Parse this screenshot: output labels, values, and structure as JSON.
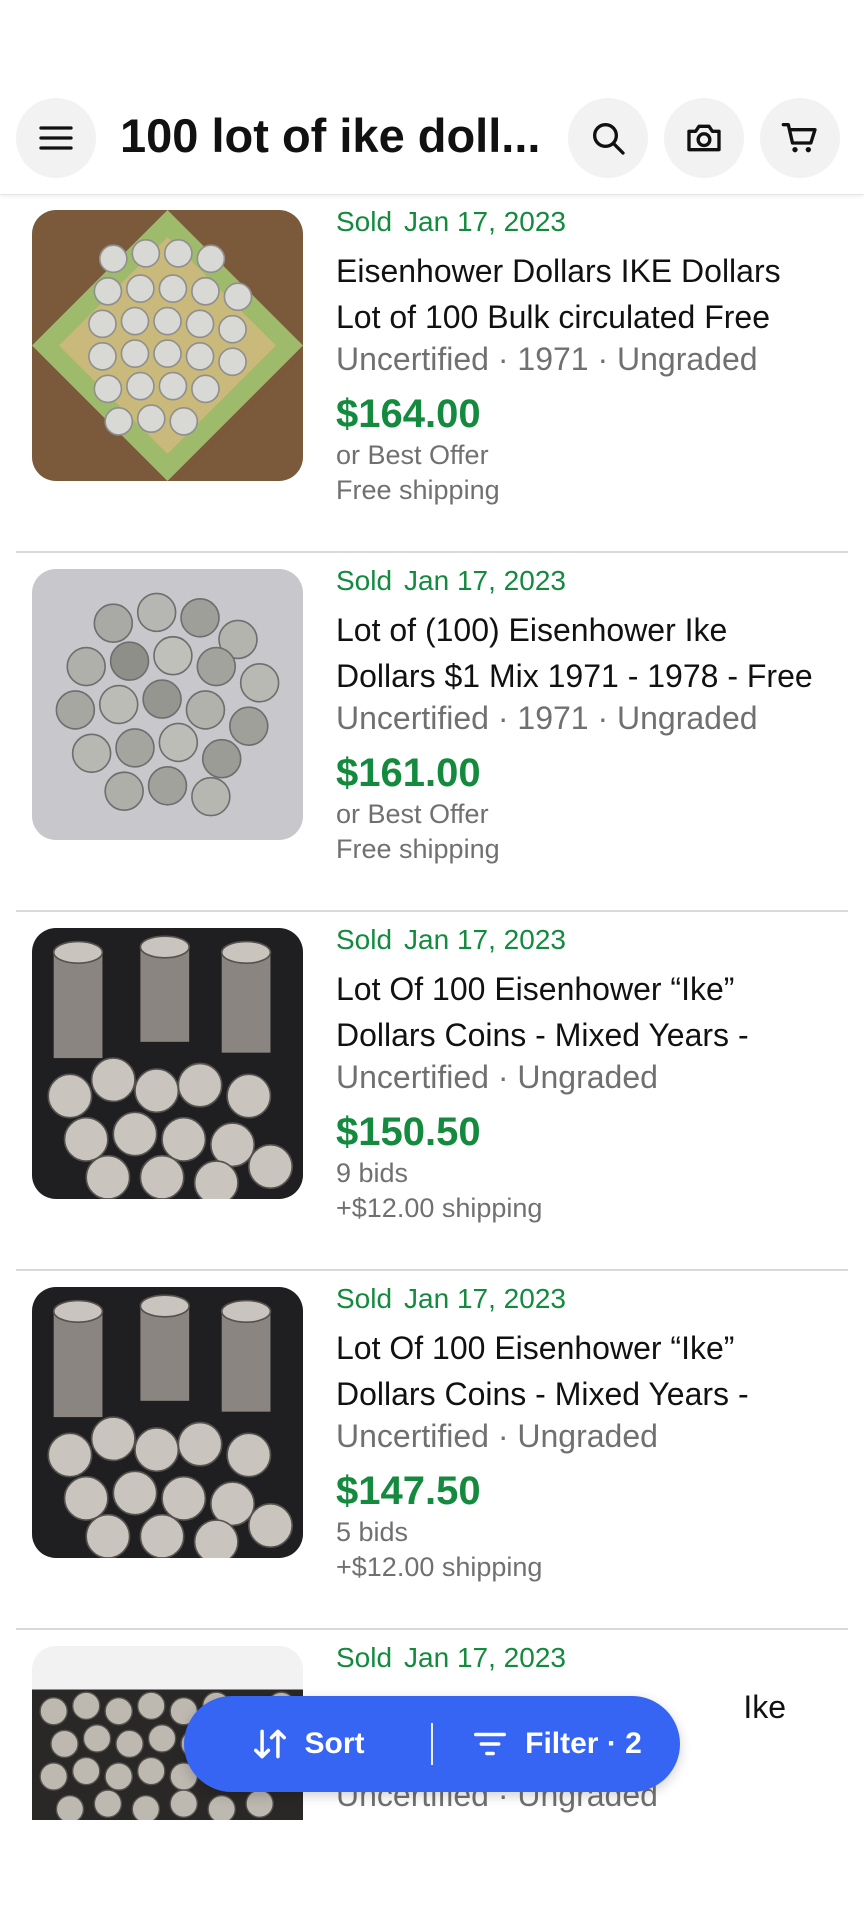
{
  "header": {
    "title": "100 lot of ike doll...",
    "icons": [
      "menu-icon",
      "search-icon",
      "camera-icon",
      "cart-icon"
    ]
  },
  "colors": {
    "sold": "#138a3e",
    "accent": "#3665f3",
    "muted": "#707070"
  },
  "listings": [
    {
      "sold_label": "Sold",
      "date": "Jan 17, 2023",
      "title_line1": "Eisenhower Dollars IKE Dollars",
      "title_line2": "Lot of 100 Bulk circulated Free",
      "meta": "Uncertified · 1971 · Ungraded",
      "price": "$164.00",
      "sub1": "or Best Offer",
      "sub2": "Free shipping"
    },
    {
      "sold_label": "Sold",
      "date": "Jan 17, 2023",
      "title_line1": "Lot of (100) Eisenhower Ike",
      "title_line2": "Dollars $1 Mix 1971 - 1978 - Free",
      "meta": "Uncertified · 1971 · Ungraded",
      "price": "$161.00",
      "sub1": "or Best Offer",
      "sub2": "Free shipping"
    },
    {
      "sold_label": "Sold",
      "date": "Jan 17, 2023",
      "title_line1": "Lot Of 100 Eisenhower “Ike”",
      "title_line2": "Dollars Coins - Mixed Years -",
      "meta": "Uncertified · Ungraded",
      "price": "$150.50",
      "sub1": "9 bids",
      "sub2": "+$12.00 shipping"
    },
    {
      "sold_label": "Sold",
      "date": "Jan 17, 2023",
      "title_line1": "Lot Of 100 Eisenhower “Ike”",
      "title_line2": "Dollars Coins - Mixed Years -",
      "meta": "Uncertified · Ungraded",
      "price": "$147.50",
      "sub1": "5 bids",
      "sub2": "+$12.00 shipping"
    },
    {
      "sold_label": "Sold",
      "date": "Jan 17, 2023",
      "title_line1": "Ike",
      "meta": "Uncertified · Ungraded"
    }
  ],
  "bottom_bar": {
    "sort_label": "Sort",
    "filter_label": "Filter · 2"
  }
}
